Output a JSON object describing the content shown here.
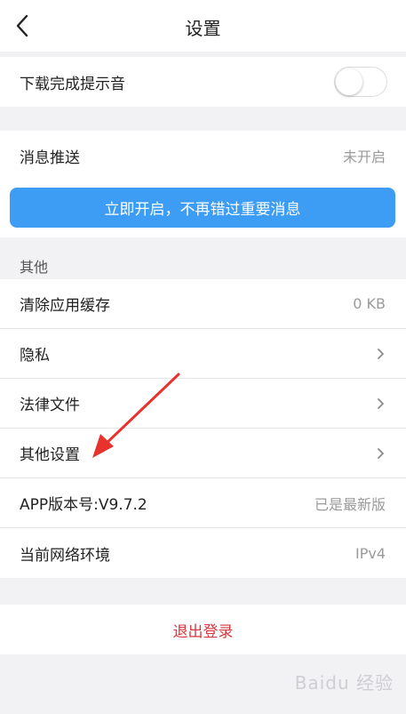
{
  "nav": {
    "title": "设置",
    "back_icon": "chevron-left-icon"
  },
  "download_sound": {
    "label": "下载完成提示音",
    "enabled": false
  },
  "push": {
    "label": "消息推送",
    "status": "未开启",
    "enable_button": "立即开启，不再错过重要消息"
  },
  "others": {
    "section_title": "其他",
    "items": [
      {
        "label": "清除应用缓存",
        "value": "0 KB",
        "chevron": false
      },
      {
        "label": "隐私",
        "value": "",
        "chevron": true
      },
      {
        "label": "法律文件",
        "value": "",
        "chevron": true
      },
      {
        "label": "其他设置",
        "value": "",
        "chevron": true
      },
      {
        "label": "APP版本号:V9.7.2",
        "value": "已是最新版",
        "chevron": false
      },
      {
        "label": "当前网络环境",
        "value": "IPv4",
        "chevron": false
      }
    ]
  },
  "logout_label": "退出登录",
  "watermark": "Baidu 经验",
  "colors": {
    "accent": "#3d9cf3",
    "danger": "#d9363e",
    "annotation_arrow": "#e8322d"
  }
}
